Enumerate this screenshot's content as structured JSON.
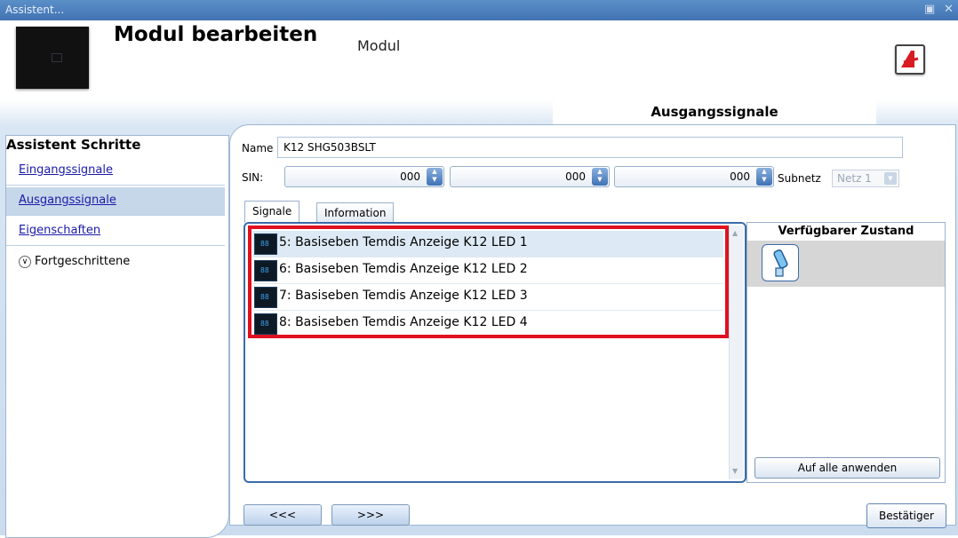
{
  "window": {
    "title": "Assistent..."
  },
  "header": {
    "title": "Modul bearbeiten",
    "subtitle": "Modul",
    "section_tab": "Ausgangssignale"
  },
  "sidebar": {
    "title": "Assistent Schritte",
    "items": [
      {
        "label": "Eingangssignale",
        "selected": false
      },
      {
        "label": "Ausgangssignale",
        "selected": true
      },
      {
        "label": "Eigenschaften",
        "selected": false
      }
    ],
    "advanced_label": "Fortgeschrittene"
  },
  "form": {
    "name_label": "Name",
    "name_value": "K12 SHG503BSLT",
    "sin_label": "SIN:",
    "sin_values": [
      "000",
      "000",
      "000"
    ],
    "subnetz_label": "Subnetz",
    "subnetz_value": "Netz 1"
  },
  "tabs": [
    {
      "label": "Signale",
      "active": true
    },
    {
      "label": "Information",
      "active": false
    }
  ],
  "signals": [
    {
      "label": "5: Basiseben Temdis Anzeige K12 LED 1",
      "selected": true
    },
    {
      "label": "6: Basiseben Temdis Anzeige K12 LED 2",
      "selected": false
    },
    {
      "label": "7: Basiseben Temdis Anzeige K12 LED 3",
      "selected": false
    },
    {
      "label": "8: Basiseben Temdis Anzeige K12 LED 4",
      "selected": false
    }
  ],
  "signal_icon_text": "88",
  "right_panel": {
    "title": "Verfügbarer Zustand",
    "apply_all_label": "Auf alle anwenden"
  },
  "footer": {
    "prev_label": "<<<",
    "next_label": ">>>",
    "confirm_label": "Bestätiger"
  },
  "colors": {
    "titlebar": "#4a7fbd",
    "highlight_box": "#e01020",
    "link": "#1a1aa8"
  }
}
